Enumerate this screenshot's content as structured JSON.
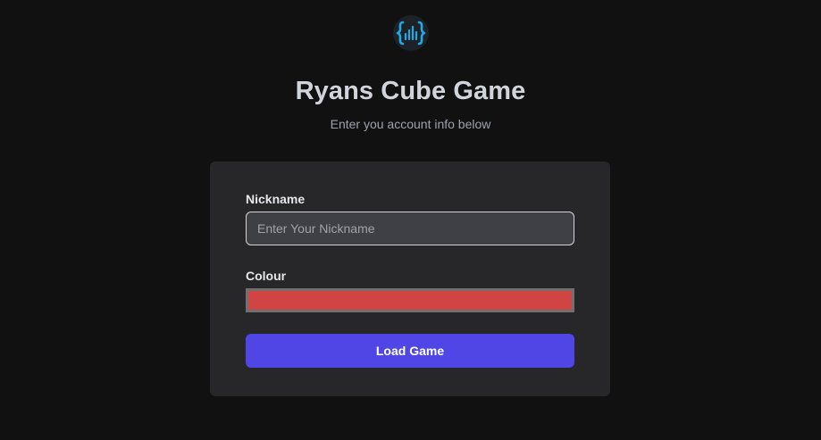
{
  "header": {
    "logo_icon": "curly-braces-audio-bars-icon",
    "title": "Ryans Cube Game",
    "subtitle": "Enter you account info below"
  },
  "form": {
    "nickname_label": "Nickname",
    "nickname_placeholder": "Enter Your Nickname",
    "nickname_value": "",
    "colour_label": "Colour",
    "colour_value": "#d14444",
    "submit_label": "Load Game"
  },
  "colors": {
    "accent": "#4f46e5",
    "logo": "#22a9e0",
    "card": "#27272a",
    "background": "#111112"
  }
}
